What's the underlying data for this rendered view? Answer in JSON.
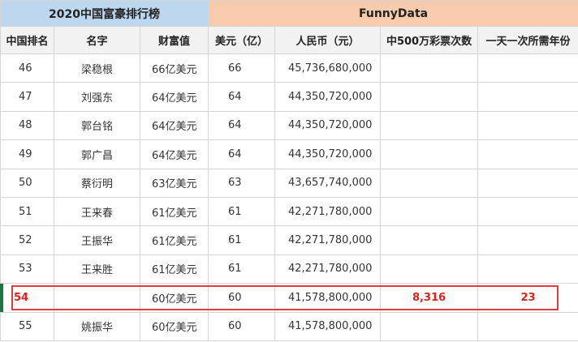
{
  "banner": {
    "left": "2020中国富豪排行榜",
    "right": "FunnyData"
  },
  "headers": [
    "中国排名",
    "名字",
    "财富值",
    "美元（亿）",
    "人民币（元）",
    "中500万彩票次数",
    "一天一次所需年份"
  ],
  "rows": [
    {
      "rank": "46",
      "name": "梁稳根",
      "wealth": "66亿美元",
      "usd": "66",
      "rmb": "45,736,680,000",
      "lottery": "",
      "years": ""
    },
    {
      "rank": "47",
      "name": "刘强东",
      "wealth": "64亿美元",
      "usd": "64",
      "rmb": "44,350,720,000",
      "lottery": "",
      "years": ""
    },
    {
      "rank": "48",
      "name": "郭台铭",
      "wealth": "64亿美元",
      "usd": "64",
      "rmb": "44,350,720,000",
      "lottery": "",
      "years": ""
    },
    {
      "rank": "49",
      "name": "郭广昌",
      "wealth": "64亿美元",
      "usd": "64",
      "rmb": "44,350,720,000",
      "lottery": "",
      "years": ""
    },
    {
      "rank": "50",
      "name": "蔡衍明",
      "wealth": "63亿美元",
      "usd": "63",
      "rmb": "43,657,740,000",
      "lottery": "",
      "years": ""
    },
    {
      "rank": "51",
      "name": "王来春",
      "wealth": "61亿美元",
      "usd": "61",
      "rmb": "42,271,780,000",
      "lottery": "",
      "years": ""
    },
    {
      "rank": "52",
      "name": "王振华",
      "wealth": "61亿美元",
      "usd": "61",
      "rmb": "42,271,780,000",
      "lottery": "",
      "years": ""
    },
    {
      "rank": "53",
      "name": "王来胜",
      "wealth": "61亿美元",
      "usd": "61",
      "rmb": "42,271,780,000",
      "lottery": "",
      "years": ""
    },
    {
      "rank": "54",
      "name": "",
      "wealth": "60亿美元",
      "usd": "60",
      "rmb": "41,578,800,000",
      "lottery": "8,316",
      "years": "23"
    },
    {
      "rank": "55",
      "name": "姚振华",
      "wealth": "60亿美元",
      "usd": "60",
      "rmb": "41,578,800,000",
      "lottery": "",
      "years": ""
    }
  ],
  "highlight_row_index": 8,
  "colors": {
    "banner_left": "#bdd7ee",
    "banner_right": "#f8cbad",
    "highlight_border": "#e23d3d",
    "highlight_text": "#e0201f",
    "active_marker": "#217346"
  }
}
